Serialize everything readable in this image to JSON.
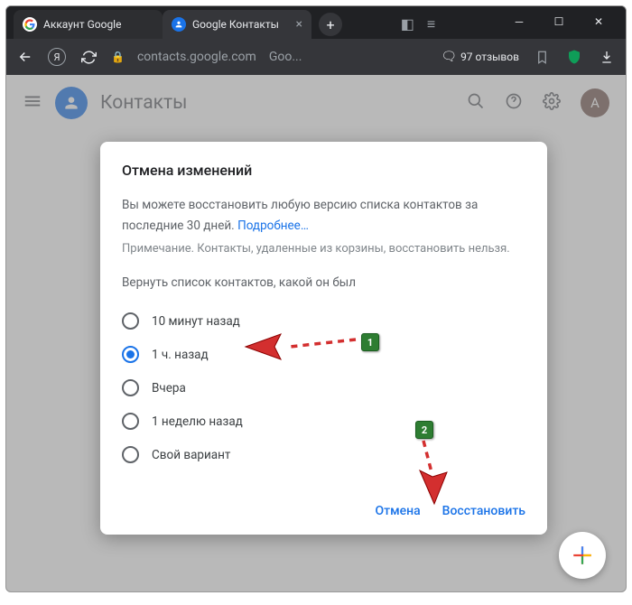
{
  "tabs": {
    "inactive": "Аккаунт Google",
    "active": "Google Контакты"
  },
  "toolbar": {
    "url": "contacts.google.com",
    "url_tail": "Goo...",
    "reviews": "97 отзывов"
  },
  "header": {
    "title": "Контакты",
    "account_letter": "A"
  },
  "dialog": {
    "title": "Отмена изменений",
    "desc_1": "Вы можете восстановить любую версию списка контактов за последние 30 дней. ",
    "learn_more": "Подробнее…",
    "note": "Примечание. Контакты, удаленные из корзины, восстановить нельзя.",
    "prompt": "Вернуть список контактов, какой он был",
    "options": [
      "10 минут назад",
      "1 ч. назад",
      "Вчера",
      "1 неделю назад",
      "Свой вариант"
    ],
    "selected_index": 1,
    "cancel": "Отмена",
    "confirm": "Восстановить"
  },
  "annotations": {
    "badge1": "1",
    "badge2": "2"
  }
}
